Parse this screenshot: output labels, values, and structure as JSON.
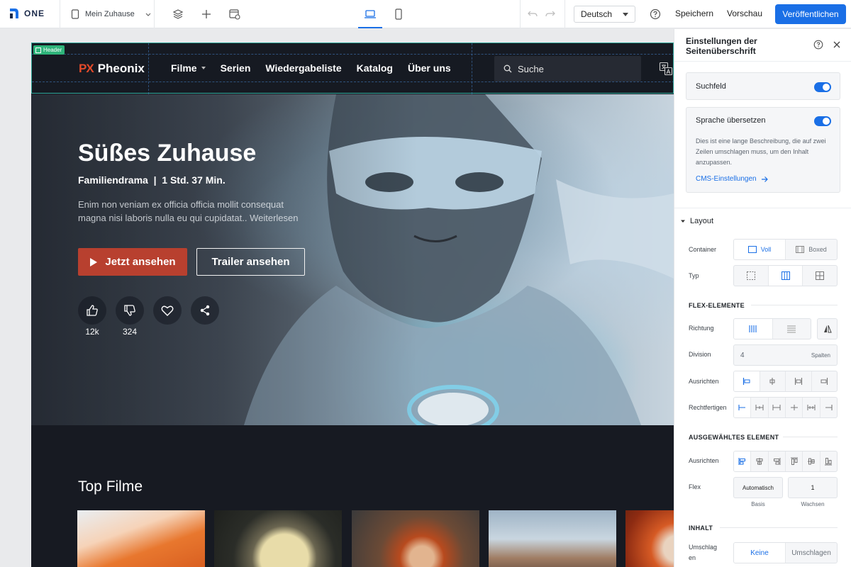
{
  "topbar": {
    "logo_text": "ONE",
    "page_name": "Mein Zuhause",
    "language": "Deutsch",
    "save_label": "Speichern",
    "preview_label": "Vorschau",
    "publish_label": "Veröffentlichen"
  },
  "site": {
    "header_tag": "Header",
    "brand_mark": "PX",
    "brand_name": "Pheonix",
    "nav": [
      "Filme",
      "Serien",
      "Wiedergabeliste",
      "Katalog",
      "Über uns"
    ],
    "search_placeholder": "Suche"
  },
  "hero": {
    "title": "Süßes Zuhause",
    "meta": "Familiendrama  |  1 Std. 37 Min.",
    "description": "Enim non veniam ex officia officia mollit consequat magna nisi laboris nulla eu qui cupidatat.. Weiterlesen",
    "watch_label": "Jetzt ansehen",
    "trailer_label": "Trailer ansehen",
    "likes": "12k",
    "dislikes": "324"
  },
  "section": {
    "title": "Top Filme"
  },
  "panel": {
    "title": "Einstellungen der Seitenüberschrift",
    "search_toggle_label": "Suchfeld",
    "translate_toggle_label": "Sprache übersetzen",
    "translate_desc": "Dies ist eine lange Beschreibung, die auf zwei Zeilen umschlagen muss, um den Inhalt anzupassen.",
    "cms_link": "CMS-Einstellungen",
    "layout_heading": "Layout",
    "container_label": "Container",
    "container_options": [
      "Voll",
      "Boxed"
    ],
    "type_label": "Typ",
    "flex_heading": "FLEX-ELEMENTE",
    "direction_label": "Richtung",
    "division_label": "Division",
    "division_value": "4",
    "division_unit": "Spalten",
    "align_label": "Ausrichten",
    "justify_label": "Rechtfertigen",
    "selected_heading": "AUSGEWÄHLTES ELEMENT",
    "sel_align_label": "Ausrichten",
    "flex_label": "Flex",
    "flex_basis_value": "Automatisch",
    "flex_grow_value": "1",
    "basis_caption": "Basis",
    "grow_caption": "Wachsen",
    "content_heading": "INHALT",
    "wrap_label": "Umschlagen",
    "wrap_options": [
      "Keine",
      "Umschlagen"
    ]
  },
  "colors": {
    "accent": "#1a6fe6",
    "cta": "#b8402f",
    "brand": "#e24a2a",
    "canvas": "#171a22",
    "tag": "#2eb47a"
  }
}
